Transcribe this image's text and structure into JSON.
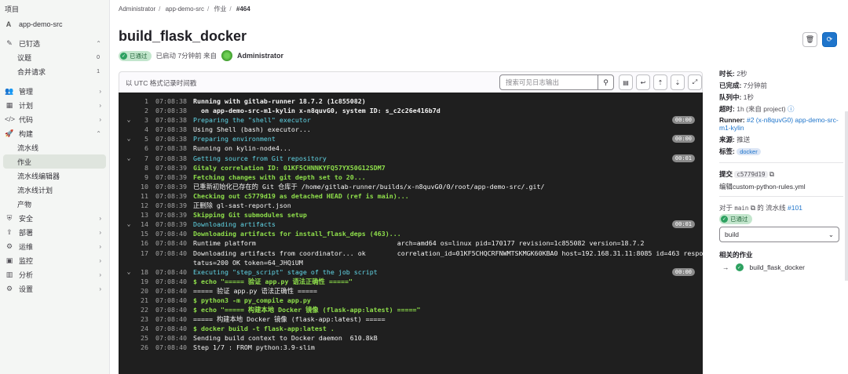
{
  "sidebar": {
    "header": "项目",
    "project": {
      "avatar": "A",
      "name": "app-demo-src"
    },
    "pinned": {
      "label": "已钉选"
    },
    "pinned_items": [
      {
        "label": "议题",
        "count": "0"
      },
      {
        "label": "合并请求",
        "count": "1"
      }
    ],
    "sections": [
      {
        "label": "管理",
        "icon": "users-icon",
        "glyph": "👥"
      },
      {
        "label": "计划",
        "icon": "calendar-icon",
        "glyph": "▦"
      },
      {
        "label": "代码",
        "icon": "code-icon",
        "glyph": "</>"
      },
      {
        "label": "构建",
        "icon": "rocket-icon",
        "glyph": "🚀"
      }
    ],
    "build_items": [
      {
        "label": "流水线",
        "active": false
      },
      {
        "label": "作业",
        "active": true
      },
      {
        "label": "流水线编辑器",
        "active": false
      },
      {
        "label": "流水线计划",
        "active": false
      },
      {
        "label": "产物",
        "active": false
      }
    ],
    "more_sections": [
      {
        "label": "安全",
        "icon": "shield-icon",
        "glyph": "⛨"
      },
      {
        "label": "部署",
        "icon": "deploy-icon",
        "glyph": "⇪"
      },
      {
        "label": "运维",
        "icon": "operate-icon",
        "glyph": "⚙"
      },
      {
        "label": "监控",
        "icon": "monitor-icon",
        "glyph": "▣"
      },
      {
        "label": "分析",
        "icon": "chart-icon",
        "glyph": "▥"
      },
      {
        "label": "设置",
        "icon": "settings-icon",
        "glyph": "⚙"
      }
    ]
  },
  "breadcrumb": {
    "items": [
      "Administrator",
      "app-demo-src",
      "作业"
    ],
    "current": "#464"
  },
  "job": {
    "title": "build_flask_docker",
    "status": "已通过",
    "started": "已启动 7分钟前 来自",
    "user": "Administrator"
  },
  "log": {
    "utc_label": "以 UTC 格式记录时间戳",
    "search_placeholder": "搜索可见日志输出",
    "lines": [
      {
        "n": "1",
        "t": "07:08:38",
        "text": "Running with gitlab-runner 18.7.2 (1c855082)",
        "cls": "c-white bold",
        "tog": "",
        "dur": ""
      },
      {
        "n": "2",
        "t": "07:08:38",
        "text": "  on app-demo-src-m1-kylin x-n8quvG0, system ID: s_c2c26e416b7d",
        "cls": "c-white bold",
        "tog": "",
        "dur": ""
      },
      {
        "n": "3",
        "t": "07:08:38",
        "text": "Preparing the \"shell\" executor",
        "cls": "c-cyan",
        "tog": "⌄",
        "dur": "00:00"
      },
      {
        "n": "4",
        "t": "07:08:38",
        "text": "Using Shell (bash) executor...",
        "cls": "c-white",
        "tog": "",
        "dur": ""
      },
      {
        "n": "5",
        "t": "07:08:38",
        "text": "Preparing environment",
        "cls": "c-cyan",
        "tog": "⌄",
        "dur": "00:00"
      },
      {
        "n": "6",
        "t": "07:08:38",
        "text": "Running on kylin-node4...",
        "cls": "c-white",
        "tog": "",
        "dur": ""
      },
      {
        "n": "7",
        "t": "07:08:38",
        "text": "Getting source from Git repository",
        "cls": "c-cyan",
        "tog": "⌄",
        "dur": "00:01"
      },
      {
        "n": "8",
        "t": "07:08:39",
        "text": "Gitaly correlation ID: 01KF5CHNNKYFQ57YX50G12SDM7",
        "cls": "c-green",
        "tog": "",
        "dur": ""
      },
      {
        "n": "9",
        "t": "07:08:39",
        "text": "Fetching changes with git depth set to 20...",
        "cls": "c-green",
        "tog": "",
        "dur": ""
      },
      {
        "n": "10",
        "t": "07:08:39",
        "text": "已重新初始化已存在的 Git 仓库于 /home/gitlab-runner/builds/x-n8quvG0/0/root/app-demo-src/.git/",
        "cls": "c-white",
        "tog": "",
        "dur": ""
      },
      {
        "n": "11",
        "t": "07:08:39",
        "text": "Checking out c5779d19 as detached HEAD (ref is main)...",
        "cls": "c-green",
        "tog": "",
        "dur": ""
      },
      {
        "n": "12",
        "t": "07:08:39",
        "text": "正删除 gl-sast-report.json",
        "cls": "c-white",
        "tog": "",
        "dur": ""
      },
      {
        "n": "13",
        "t": "07:08:39",
        "text": "Skipping Git submodules setup",
        "cls": "c-green",
        "tog": "",
        "dur": ""
      },
      {
        "n": "14",
        "t": "07:08:39",
        "text": "Downloading artifacts",
        "cls": "c-cyan",
        "tog": "⌄",
        "dur": "00:01"
      },
      {
        "n": "15",
        "t": "07:08:40",
        "text": "Downloading artifacts for install_flask_deps (463)...",
        "cls": "c-green",
        "tog": "",
        "dur": ""
      },
      {
        "n": "16",
        "t": "07:08:40",
        "text": "Runtime platform                                    arch=amd64 os=linux pid=170177 revision=1c855082 version=18.7.2",
        "cls": "c-white",
        "tog": "",
        "dur": ""
      },
      {
        "n": "17",
        "t": "07:08:40",
        "text": "Downloading artifacts from coordinator... ok        correlation_id=01KF5CHQCRFNWMTSKMGK60KBA0 host=192.168.31.11:8085 id=463 responseS",
        "cls": "c-white",
        "tog": "",
        "dur": ""
      },
      {
        "n": "",
        "t": "",
        "text": "tatus=200 OK token=64_JHQiUM",
        "cls": "c-white",
        "tog": "",
        "dur": ""
      },
      {
        "n": "18",
        "t": "07:08:40",
        "text": "Executing \"step_script\" stage of the job script",
        "cls": "c-cyan",
        "tog": "⌄",
        "dur": "00:00"
      },
      {
        "n": "19",
        "t": "07:08:40",
        "text": "$ echo \"===== 验证 app.py 语法正确性 =====\"",
        "cls": "c-green",
        "tog": "",
        "dur": ""
      },
      {
        "n": "20",
        "t": "07:08:40",
        "text": "===== 验证 app.py 语法正确性 =====",
        "cls": "c-white",
        "tog": "",
        "dur": ""
      },
      {
        "n": "21",
        "t": "07:08:40",
        "text": "$ python3 -m py_compile app.py",
        "cls": "c-green",
        "tog": "",
        "dur": ""
      },
      {
        "n": "22",
        "t": "07:08:40",
        "text": "$ echo \"===== 构建本地 Docker 镜像 (flask-app:latest) =====\"",
        "cls": "c-green",
        "tog": "",
        "dur": ""
      },
      {
        "n": "23",
        "t": "07:08:40",
        "text": "===== 构建本地 Docker 镜像 (flask-app:latest) =====",
        "cls": "c-white",
        "tog": "",
        "dur": ""
      },
      {
        "n": "24",
        "t": "07:08:40",
        "text": "$ docker build -t flask-app:latest .",
        "cls": "c-green",
        "tog": "",
        "dur": ""
      },
      {
        "n": "25",
        "t": "07:08:40",
        "text": "Sending build context to Docker daemon  610.8kB",
        "cls": "c-white",
        "tog": "",
        "dur": ""
      },
      {
        "n": "26",
        "t": "07:08:40",
        "text": "Step 1/7 : FROM python:3.9-slim",
        "cls": "c-white",
        "tog": "",
        "dur": ""
      }
    ]
  },
  "details": {
    "duration_label": "时长:",
    "duration": "2秒",
    "finished_label": "已完成:",
    "finished": "7分钟前",
    "queued_label": "队列中:",
    "queued": "1秒",
    "timeout_label": "超时:",
    "timeout": "1h (来自 project)",
    "runner_label": "Runner:",
    "runner": "#2 (x-n8quvG0) app-demo-src-m1-kylin",
    "source_label": "来源:",
    "source": "推送",
    "tags_label": "标签:",
    "tag": "docker",
    "commit_label": "提交",
    "commit": "c5779d19",
    "commit_msg": "编辑custom-python-rules.yml",
    "pipeline_prefix": "对于",
    "branch": "main",
    "pipeline_mid": "的 流水线",
    "pipeline": "#101",
    "pipeline_status": "已通过",
    "stage": "build",
    "related_label": "相关的作业",
    "related_job": "build_flask_docker"
  }
}
